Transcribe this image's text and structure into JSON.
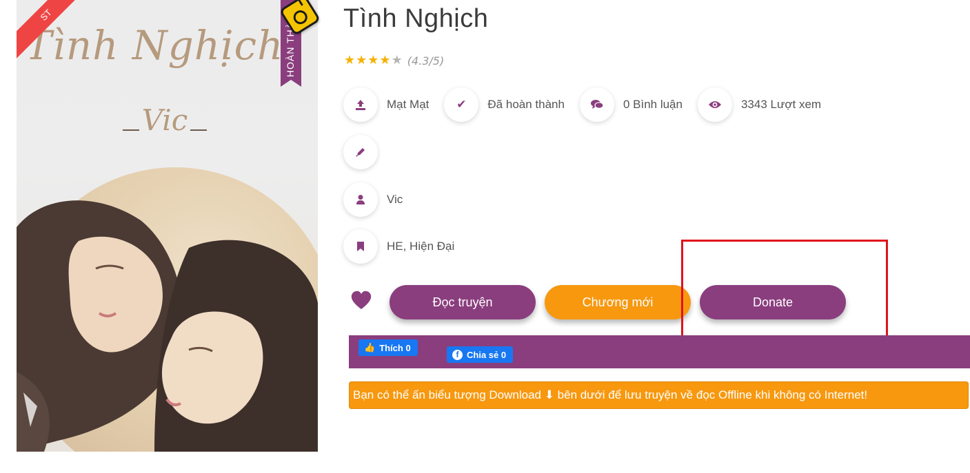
{
  "cover": {
    "title_art": "Tình Nghịch",
    "author_art": "Vic",
    "corner_badge": "ST",
    "status_tab": "HOÀN THÀNH"
  },
  "story": {
    "title": "Tình Nghịch",
    "rating_text": "(4.3/5)",
    "rating_value": 4.3,
    "rating_max": 5
  },
  "meta": {
    "uploader": "Mạt Mạt",
    "status": "Đã hoàn thành",
    "comments": "0 Bình luận",
    "views": "3343 Lượt xem",
    "author": "Vic",
    "genres": "HE,  Hiện Đại"
  },
  "actions": {
    "read": "Đọc truyện",
    "new_chapter": "Chương mới",
    "donate": "Donate"
  },
  "social": {
    "like": "Thích 0",
    "share": "Chia sẻ 0"
  },
  "notice": {
    "text": "Bạn có thể ấn biểu tượng Download ⬇ bên dưới để lưu truyện về đọc Offline khi không có Internet!"
  },
  "colors": {
    "brand_purple": "#8a3e7e",
    "accent_orange": "#f7980f",
    "star": "#f6b100",
    "highlight_red": "#e0121b",
    "facebook_blue": "#1877f2"
  }
}
